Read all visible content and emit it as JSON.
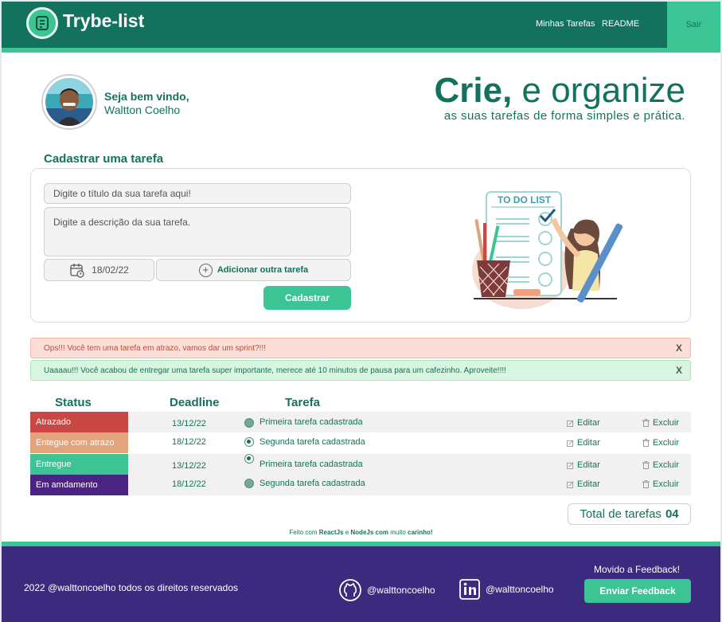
{
  "header": {
    "app_title": "Trybe-list",
    "nav": [
      "Minhas Tarefas",
      "README"
    ],
    "logout": "Sair"
  },
  "colors": {
    "primary": "#13725d",
    "accent": "#3cc494",
    "footer": "#3c2a7e",
    "status_late": "#c94744",
    "status_delivered_late": "#e2a47c",
    "status_delivered": "#3cc494",
    "status_in_progress": "#4b2483"
  },
  "user": {
    "greeting": "Seja bem vindo,",
    "name": "Waltton Coelho"
  },
  "hero": {
    "title_bold": "Crie,",
    "title_rest": " e organize",
    "subtitle": "as suas tarefas de forma simples e prática."
  },
  "form": {
    "section_title": "Cadastrar uma tarefa",
    "title_placeholder": "Digite o título da sua tarefa aqui!",
    "description_placeholder": "Digite a descrição da sua tarefa.",
    "date_value": "18/02/22",
    "add_another_label": "Adicionar outra tarefa",
    "submit_label": "Cadastrar",
    "illustration_label": "TO DO LIST"
  },
  "alerts": {
    "danger": "Ops!!! Você tem uma tarefa em atrazo, vamos dar um sprint?!!!",
    "success": "Uaaaau!!! Você acabou de entregar uma tarefa super importante, merece até 10 minutos de pausa para um cafezinho. Aproveite!!!!",
    "close": "X"
  },
  "table": {
    "headers": {
      "status": "Status",
      "deadline": "Deadline",
      "task": "Tarefa"
    },
    "edit_label": "Editar",
    "delete_label": "Excluir",
    "rows": [
      {
        "status": "Atrazado",
        "deadline": "13/12/22",
        "task": "Primeira tarefa cadastrada"
      },
      {
        "status": "Entegue com atrazo",
        "deadline": "18/12/22",
        "task": "Segunda  tarefa cadastrada"
      },
      {
        "status": "Entregue",
        "deadline": "13/12/22",
        "task": "Primeira tarefa cadastrada"
      },
      {
        "status": "Em amdamento",
        "deadline": "18/12/22",
        "task": "Segunda  tarefa cadastrada"
      }
    ],
    "total_label": "Total de tarefas",
    "total_value": "04"
  },
  "made_with": {
    "prefix": "Feito com",
    "tech1": "ReactJs",
    "and": "e",
    "tech2": "NodeJs com",
    "middle": "muito",
    "suffix": "carinho!"
  },
  "footer": {
    "copyright": "2022 @walttoncoelho todos os direitos reservados",
    "github": "@walttoncoelho",
    "linkedin": "@walttoncoelho",
    "feedback_prompt": "Movido a Feedback!",
    "feedback_button": "Enviar Feedback"
  }
}
